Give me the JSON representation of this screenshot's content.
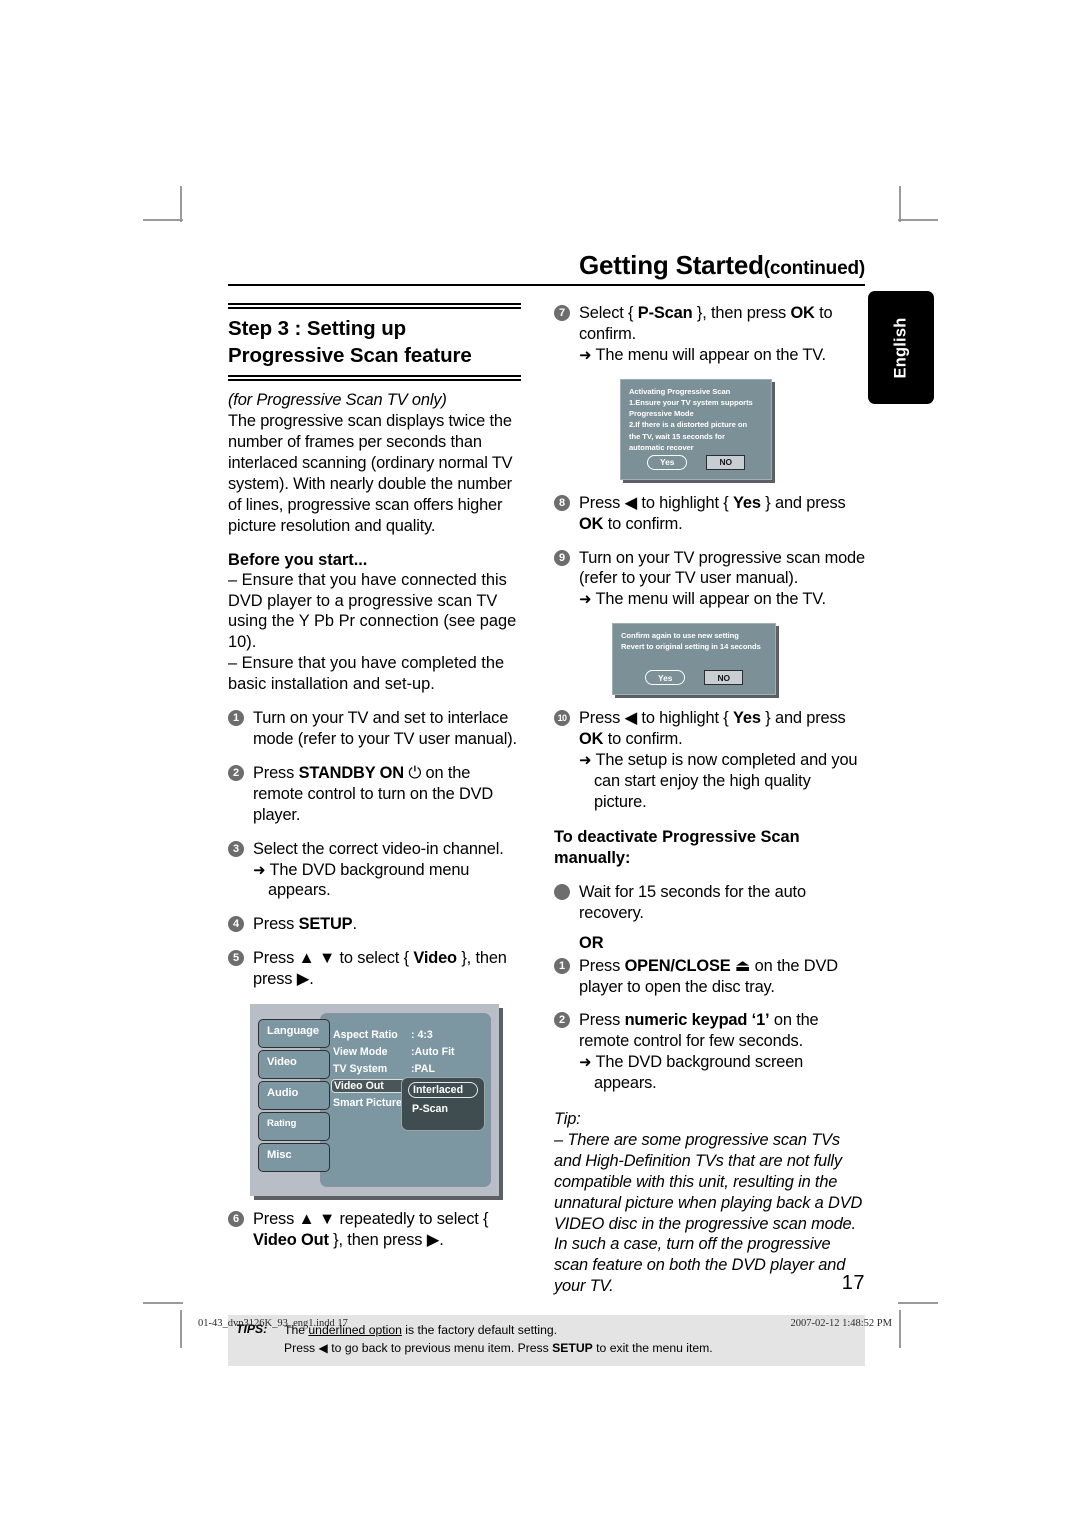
{
  "header": {
    "title": "Getting Started",
    "continued": "(continued)",
    "language_tab": "English",
    "page_number": "17"
  },
  "left_column": {
    "section_title_line1": "Step 3 : Setting up",
    "section_title_line2": "Progressive Scan feature",
    "intro_italic": "(for Progressive Scan TV only)",
    "intro_body": "The progressive scan displays twice the number of frames per seconds than interlaced scanning (ordinary normal TV system). With nearly double the number of lines, progressive scan offers higher picture resolution and quality.",
    "before_heading": "Before you start...",
    "before_item1": "– Ensure that you have connected this DVD player to a progressive scan TV using the Y Pb Pr connection (see page 10).",
    "before_item2": "– Ensure that you have completed the basic installation and set-up.",
    "steps": [
      {
        "num": "1",
        "text": "Turn on your TV and set to interlace mode (refer to your TV user manual)."
      },
      {
        "num": "2",
        "pre": "Press ",
        "bold": "STANDBY ON",
        "icon": "power-icon",
        "post": " on the remote control to turn on the DVD player."
      },
      {
        "num": "3",
        "text": "Select the correct video-in channel.",
        "arrow": "The DVD background menu appears."
      },
      {
        "num": "4",
        "pre": "Press ",
        "bold": "SETUP",
        "post": "."
      },
      {
        "num": "5",
        "pre": "Press ▲ ▼ to select { ",
        "bold": "Video",
        "post": " }, then press ▶."
      },
      {
        "num": "6",
        "pre": "Press ▲ ▼ repeatedly to select { ",
        "bold": "Video Out",
        "post": " }, then press ▶."
      }
    ]
  },
  "dvd_menu": {
    "sidebar": [
      "Language",
      "Video",
      "Audio",
      "Rating",
      "Misc"
    ],
    "selected_sidebar": "Video",
    "rows": [
      {
        "label": "Aspect Ratio",
        "value": ": 4:3"
      },
      {
        "label": "View Mode",
        "value": ":Auto Fit"
      },
      {
        "label": "TV System",
        "value": ":PAL"
      },
      {
        "label": "Video Out",
        "value": ""
      },
      {
        "label": "Smart Picture",
        "value": ""
      }
    ],
    "selected_row": "Video Out",
    "popup_options": [
      "Interlaced",
      "P-Scan"
    ],
    "popup_highlighted": "Interlaced"
  },
  "right_column": {
    "steps": [
      {
        "num": "7",
        "pre": "Select { ",
        "bold": "P-Scan",
        "mid": " }, then press ",
        "bold2": "OK",
        "post": " to confirm.",
        "arrow": "The menu will appear on the TV."
      },
      {
        "num": "8",
        "pre": "Press ◀ to highlight { ",
        "bold": "Yes",
        "mid": " } and press ",
        "bold2": "OK",
        "post": " to confirm."
      },
      {
        "num": "9",
        "text": "Turn on your TV progressive scan mode (refer to your TV user manual).",
        "arrow": "The menu will appear on the TV."
      },
      {
        "num": "10",
        "pre": "Press ◀ to highlight { ",
        "bold": "Yes",
        "mid": " } and press ",
        "bold2": "OK",
        "post": " to confirm.",
        "arrow": "The setup is now completed and you can start enjoy the high quality picture."
      }
    ],
    "deactivate_heading_line1": "To deactivate Progressive Scan",
    "deactivate_heading_line2": "manually:",
    "bullet_item": "Wait for 15 seconds for the auto recovery.",
    "or_label": "OR",
    "or_steps": [
      {
        "num": "1",
        "pre": "Press ",
        "bold": "OPEN/CLOSE",
        "icon": "eject-icon",
        "post": " on the DVD player to open the disc tray."
      },
      {
        "num": "2",
        "pre": "Press ",
        "bold": "numeric keypad ‘1’",
        "post": " on the remote control for few seconds.",
        "arrow": "The DVD background screen appears."
      }
    ],
    "tip_label": "Tip:",
    "tip_body": "– There are some progressive scan TVs and High-Definition TVs that are not fully compatible with this unit, resulting in the unnatural picture when playing back a DVD VIDEO disc in the progressive scan mode. In such a case, turn off the progressive scan feature on both the DVD player and your TV."
  },
  "osd_dialog_1": {
    "line1": "Activating Progressive Scan",
    "line2": "1.Ensure your TV system supports",
    "line3": "Progressive Mode",
    "line4": "2.If there is a distorted picture on",
    "line5": "the TV, wait 15 seconds for",
    "line6": "automatic recover",
    "yes": "Yes",
    "no": "NO"
  },
  "osd_dialog_2": {
    "line1": "Confirm again to use new setting",
    "line2": "Revert to original setting in 14 seconds",
    "yes": "Yes",
    "no": "NO"
  },
  "tips_footer": {
    "label": "TIPS:",
    "line1_pre": "The ",
    "line1_underline": "underlined option",
    "line1_post": " is the factory default setting.",
    "line2_pre": "Press  ◀ to go back to previous menu item. Press ",
    "line2_bold": "SETUP",
    "line2_post": " to exit the menu item."
  },
  "print_footer": {
    "left": "01-43_dvp3126K_93_eng1.indd   17",
    "right": "2007-02-12   1:48:52 PM"
  }
}
